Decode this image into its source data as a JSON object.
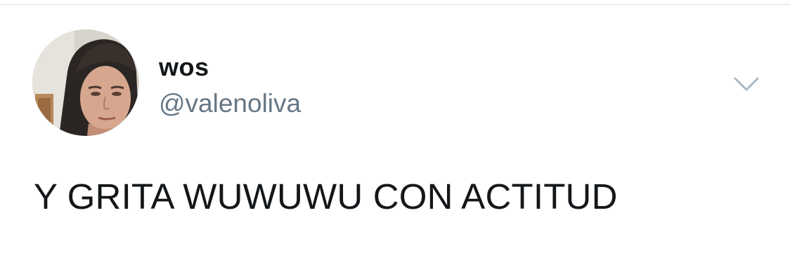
{
  "tweet": {
    "author": {
      "display_name": "wos",
      "handle": "@valenoliva",
      "avatar_icon": "profile-photo"
    },
    "menu_icon": "chevron-down-icon",
    "text": "Y GRITA WUWUWU CON ACTITUD"
  },
  "colors": {
    "background": "#ffffff",
    "name": "#14171a",
    "handle": "#657786",
    "caret": "#aab8c2"
  }
}
